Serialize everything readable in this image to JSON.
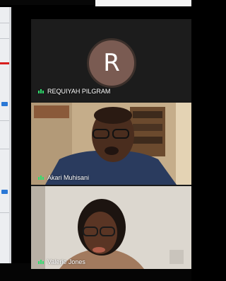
{
  "participants": [
    {
      "name": "REQUIYAH PILGRAM",
      "initial": "R",
      "avatar_color": "#7a5b52",
      "video": false
    },
    {
      "name": "Akari Muhisani",
      "video": true
    },
    {
      "name": "Valerie Jones",
      "video": true
    }
  ],
  "colors": {
    "panel_bg": "#1a1a1a",
    "audio_indicator": "#2ee06e"
  },
  "icons": {
    "audio_indicator": "audio-level-icon"
  }
}
